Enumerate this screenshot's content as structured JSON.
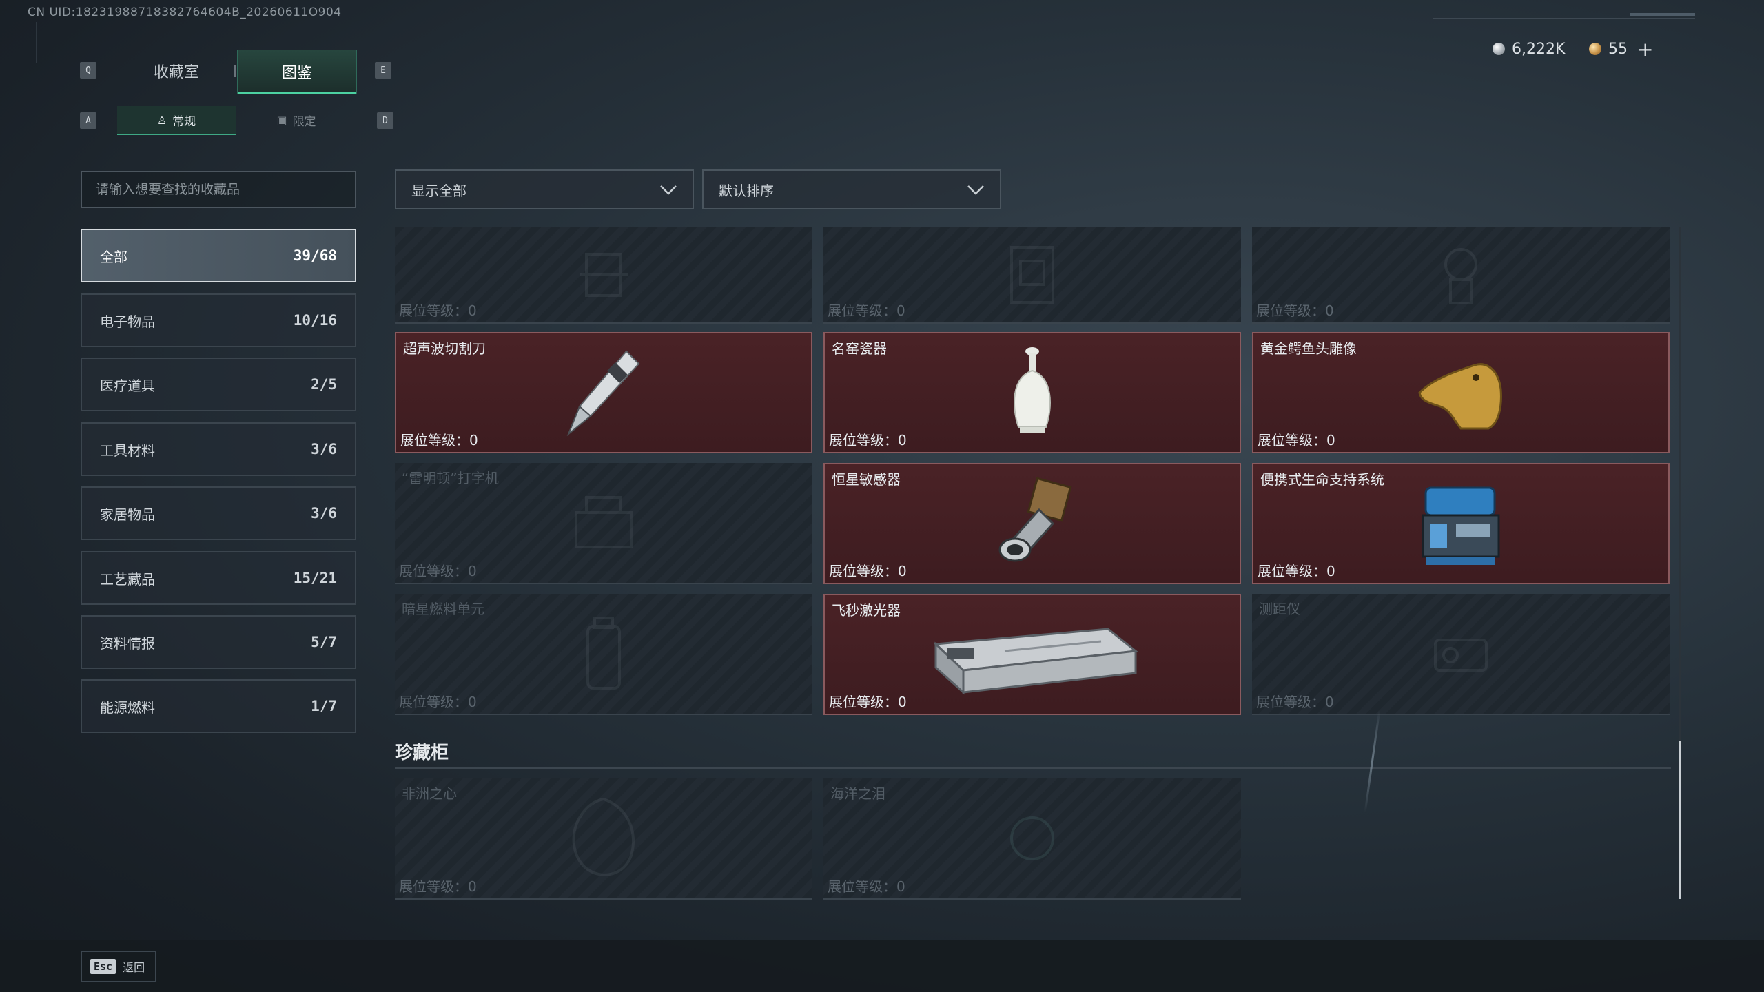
{
  "uid_text": "CN UID:18231988718382764604B_20260611O904",
  "currency": {
    "silver": "6,222K",
    "gold": "55",
    "add": "+"
  },
  "tabs": {
    "q_key": "Q",
    "e_key": "E",
    "collection_room": "收藏室",
    "catalog": "图鉴"
  },
  "subtabs": {
    "a_key": "A",
    "d_key": "D",
    "regular": "常规",
    "limited": "限定"
  },
  "search": {
    "placeholder": "请输入想要查找的收藏品"
  },
  "categories": [
    {
      "label": "全部",
      "count": "39/68"
    },
    {
      "label": "电子物品",
      "count": "10/16"
    },
    {
      "label": "医疗道具",
      "count": "2/5"
    },
    {
      "label": "工具材料",
      "count": "3/6"
    },
    {
      "label": "家居物品",
      "count": "3/6"
    },
    {
      "label": "工艺藏品",
      "count": "15/21"
    },
    {
      "label": "资料情报",
      "count": "5/7"
    },
    {
      "label": "能源燃料",
      "count": "1/7"
    }
  ],
  "filters": {
    "show_all": "显示全部",
    "default_sort": "默认排序"
  },
  "level_label": "展位等级：",
  "items": [
    {
      "name": "",
      "level": "0",
      "unlocked": false,
      "icon": "tool-icon"
    },
    {
      "name": "",
      "level": "0",
      "unlocked": false,
      "icon": "safe-icon"
    },
    {
      "name": "",
      "level": "0",
      "unlocked": false,
      "icon": "device-icon"
    },
    {
      "name": "超声波切割刀",
      "level": "0",
      "unlocked": true,
      "icon": "ultrasonic-knife-icon"
    },
    {
      "name": "名窑瓷器",
      "level": "0",
      "unlocked": true,
      "icon": "porcelain-vase-icon"
    },
    {
      "name": "黄金鳄鱼头雕像",
      "level": "0",
      "unlocked": true,
      "icon": "gold-crocodile-head-icon"
    },
    {
      "name": "“雷明顿”打字机",
      "level": "0",
      "unlocked": false,
      "icon": "typewriter-icon"
    },
    {
      "name": "恒星敏感器",
      "level": "0",
      "unlocked": true,
      "icon": "star-sensor-icon"
    },
    {
      "name": "便携式生命支持系统",
      "level": "0",
      "unlocked": true,
      "icon": "life-support-icon"
    },
    {
      "name": "暗星燃料单元",
      "level": "0",
      "unlocked": false,
      "icon": "fuel-cell-icon"
    },
    {
      "name": "飞秒激光器",
      "level": "0",
      "unlocked": true,
      "icon": "femtosecond-laser-icon"
    },
    {
      "name": "测距仪",
      "level": "0",
      "unlocked": false,
      "icon": "rangefinder-icon"
    }
  ],
  "showcase": {
    "title": "珍藏柜",
    "items": [
      {
        "name": "非洲之心",
        "level": "0",
        "unlocked": false,
        "icon": "diamond-icon"
      },
      {
        "name": "海洋之泪",
        "level": "0",
        "unlocked": false,
        "icon": "gem-icon"
      }
    ]
  },
  "footer": {
    "esc_key": "Esc",
    "back": "返回"
  }
}
